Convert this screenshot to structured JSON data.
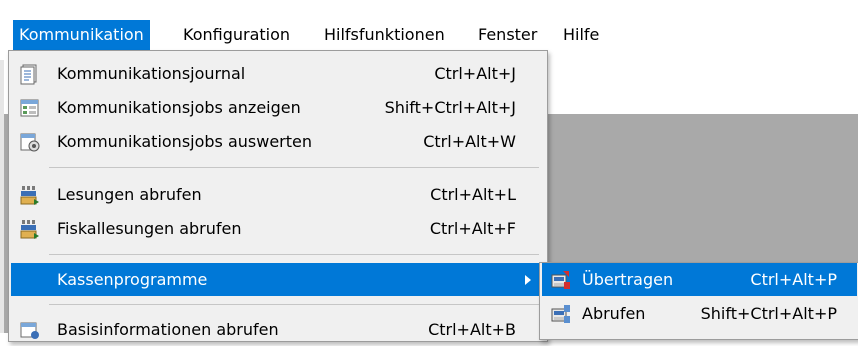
{
  "menubar": {
    "items": [
      {
        "label": "Kommunikation",
        "active": true
      },
      {
        "label": "Konfiguration",
        "active": false
      },
      {
        "label": "Hilfsfunktionen",
        "active": false
      },
      {
        "label": "Fenster",
        "active": false
      },
      {
        "label": "Hilfe",
        "active": false
      }
    ]
  },
  "kommunikation_menu": {
    "items": [
      {
        "label": "Kommunikationsjournal",
        "shortcut": "Ctrl+Alt+J",
        "icon": "journal-icon"
      },
      {
        "label": "Kommunikationsjobs anzeigen",
        "shortcut": "Shift+Ctrl+Alt+J",
        "icon": "jobs-list-icon"
      },
      {
        "label": "Kommunikationsjobs auswerten",
        "shortcut": "Ctrl+Alt+W",
        "icon": "jobs-evaluate-icon"
      },
      {
        "label": "Lesungen abrufen",
        "shortcut": "Ctrl+Alt+L",
        "icon": "register-read-icon"
      },
      {
        "label": "Fiskallesungen abrufen",
        "shortcut": "Ctrl+Alt+F",
        "icon": "fiscal-read-icon"
      },
      {
        "label": "Kassenprogramme",
        "shortcut": "",
        "icon": "",
        "submenu": true
      },
      {
        "label": "Basisinformationen abrufen",
        "shortcut": "Ctrl+Alt+B",
        "icon": "base-info-icon"
      }
    ]
  },
  "kassenprogramme_submenu": {
    "items": [
      {
        "label": "Übertragen",
        "shortcut": "Ctrl+Alt+P",
        "icon": "transfer-icon"
      },
      {
        "label": "Abrufen",
        "shortcut": "Shift+Ctrl+Alt+P",
        "icon": "retrieve-icon"
      }
    ]
  },
  "colors": {
    "highlight": "#0078d7",
    "menu_bg": "#f0f0f0",
    "workspace": "#a9a9a9"
  }
}
